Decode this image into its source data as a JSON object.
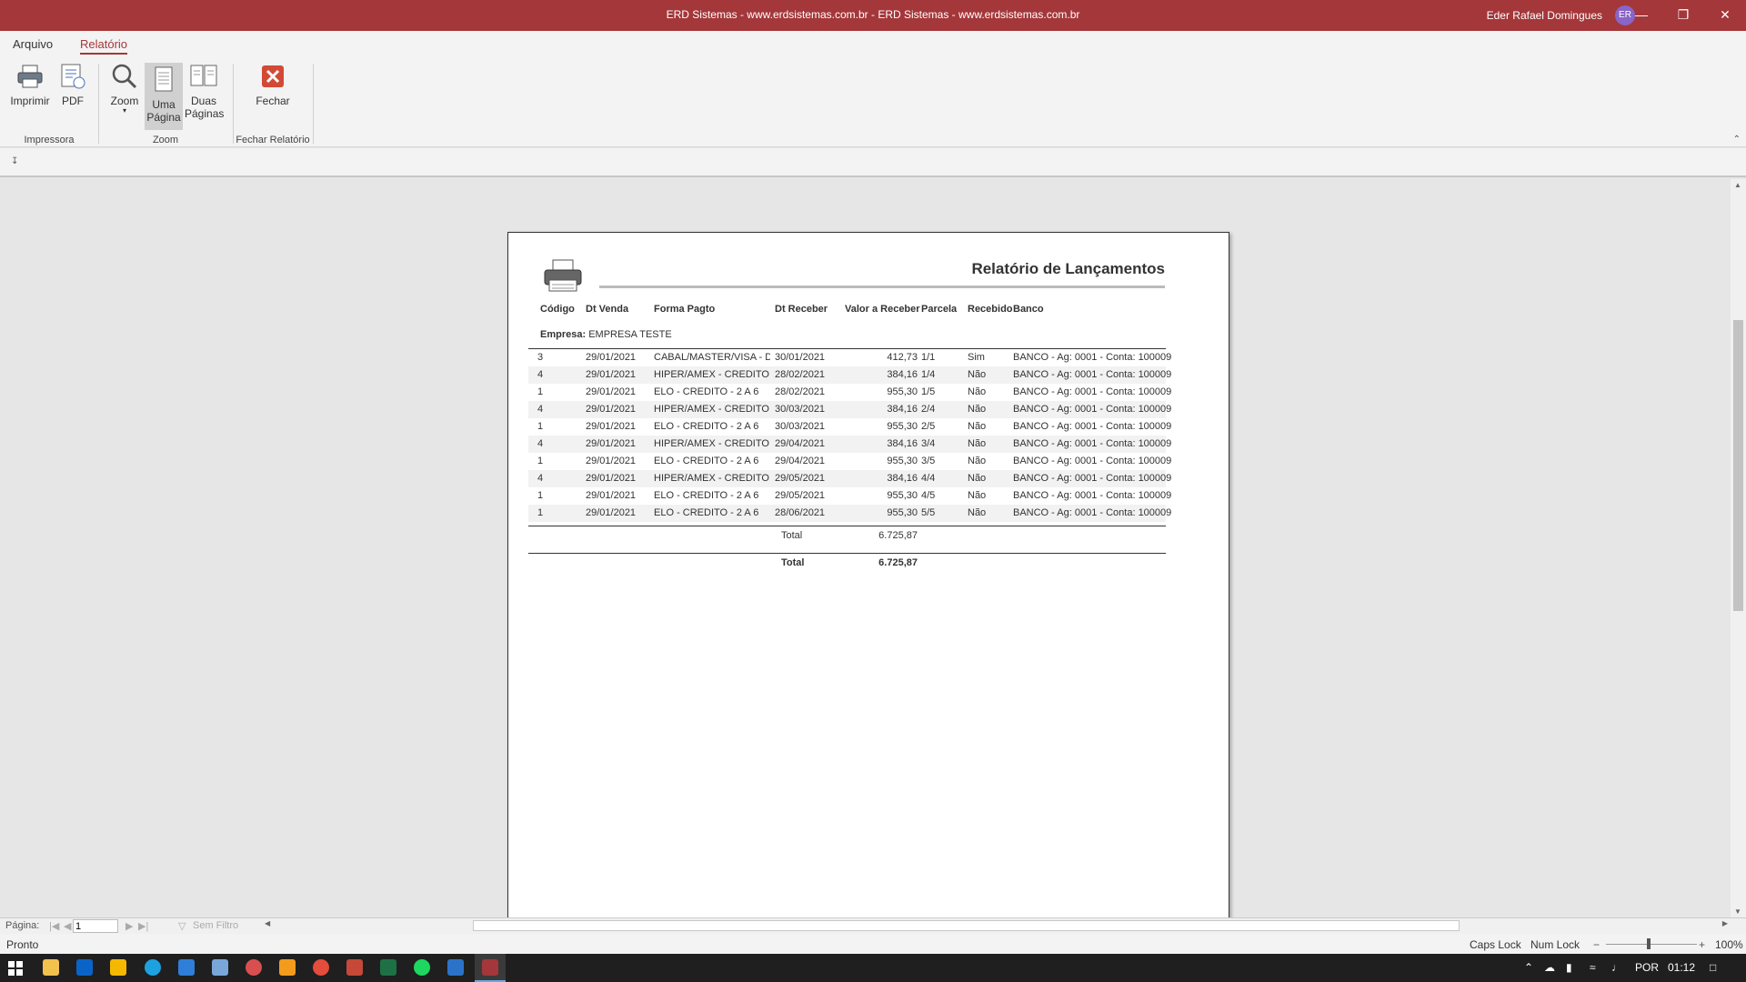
{
  "window": {
    "title": "ERD Sistemas - www.erdsistemas.com.br  -  ERD Sistemas - www.erdsistemas.com.br",
    "user": "Eder Rafael Domingues",
    "avatar_initials": "ER"
  },
  "menu": {
    "items": [
      "Arquivo",
      "Relatório"
    ],
    "active": "Relatório"
  },
  "ribbon": {
    "imprimir": "Imprimir",
    "pdf": "PDF",
    "zoom": "Zoom",
    "uma_pagina_1": "Uma",
    "uma_pagina_2": "Página",
    "duas_paginas_1": "Duas",
    "duas_paginas_2": "Páginas",
    "fechar": "Fechar",
    "groups": {
      "impressora": "Impressora",
      "zoom": "Zoom",
      "fechar": "Fechar Relatório"
    }
  },
  "report": {
    "title": "Relatório de Lançamentos",
    "headers": {
      "codigo": "Código",
      "dt_venda": "Dt Venda",
      "forma": "Forma Pagto",
      "dt_receber": "Dt Receber",
      "valor": "Valor a Receber",
      "parcela": "Parcela",
      "recebido": "Recebido",
      "banco": "Banco"
    },
    "empresa_label": "Empresa:",
    "empresa_value": "EMPRESA TESTE",
    "rows": [
      [
        "3",
        "29/01/2021",
        "CABAL/MASTER/VISA - DE",
        "30/01/2021",
        "412,73",
        "1/1",
        "Sim",
        "BANCO - Ag: 0001 - Conta: 100009"
      ],
      [
        "4",
        "29/01/2021",
        "HIPER/AMEX - CREDITO -",
        "28/02/2021",
        "384,16",
        "1/4",
        "Não",
        "BANCO - Ag: 0001 - Conta: 100009"
      ],
      [
        "1",
        "29/01/2021",
        "ELO - CREDITO - 2 A 6",
        "28/02/2021",
        "955,30",
        "1/5",
        "Não",
        "BANCO - Ag: 0001 - Conta: 100009"
      ],
      [
        "4",
        "29/01/2021",
        "HIPER/AMEX - CREDITO -",
        "30/03/2021",
        "384,16",
        "2/4",
        "Não",
        "BANCO - Ag: 0001 - Conta: 100009"
      ],
      [
        "1",
        "29/01/2021",
        "ELO - CREDITO - 2 A 6",
        "30/03/2021",
        "955,30",
        "2/5",
        "Não",
        "BANCO - Ag: 0001 - Conta: 100009"
      ],
      [
        "4",
        "29/01/2021",
        "HIPER/AMEX - CREDITO -",
        "29/04/2021",
        "384,16",
        "3/4",
        "Não",
        "BANCO - Ag: 0001 - Conta: 100009"
      ],
      [
        "1",
        "29/01/2021",
        "ELO - CREDITO - 2 A 6",
        "29/04/2021",
        "955,30",
        "3/5",
        "Não",
        "BANCO - Ag: 0001 - Conta: 100009"
      ],
      [
        "4",
        "29/01/2021",
        "HIPER/AMEX - CREDITO -",
        "29/05/2021",
        "384,16",
        "4/4",
        "Não",
        "BANCO - Ag: 0001 - Conta: 100009"
      ],
      [
        "1",
        "29/01/2021",
        "ELO - CREDITO - 2 A 6",
        "29/05/2021",
        "955,30",
        "4/5",
        "Não",
        "BANCO - Ag: 0001 - Conta: 100009"
      ],
      [
        "1",
        "29/01/2021",
        "ELO - CREDITO - 2 A 6",
        "28/06/2021",
        "955,30",
        "5/5",
        "Não",
        "BANCO - Ag: 0001 - Conta: 100009"
      ]
    ],
    "subtotal_label": "Total",
    "subtotal_value": "6.725,87",
    "total_label": "Total",
    "total_value": "6.725,87"
  },
  "navigation": {
    "label": "Página:",
    "page_value": "1",
    "filter": "Sem Filtro"
  },
  "status": {
    "text": "Pronto",
    "caps": "Caps Lock",
    "num": "Num Lock",
    "zoom_level": "100%"
  },
  "taskbar": {
    "lang": "POR",
    "time": "01:12"
  }
}
